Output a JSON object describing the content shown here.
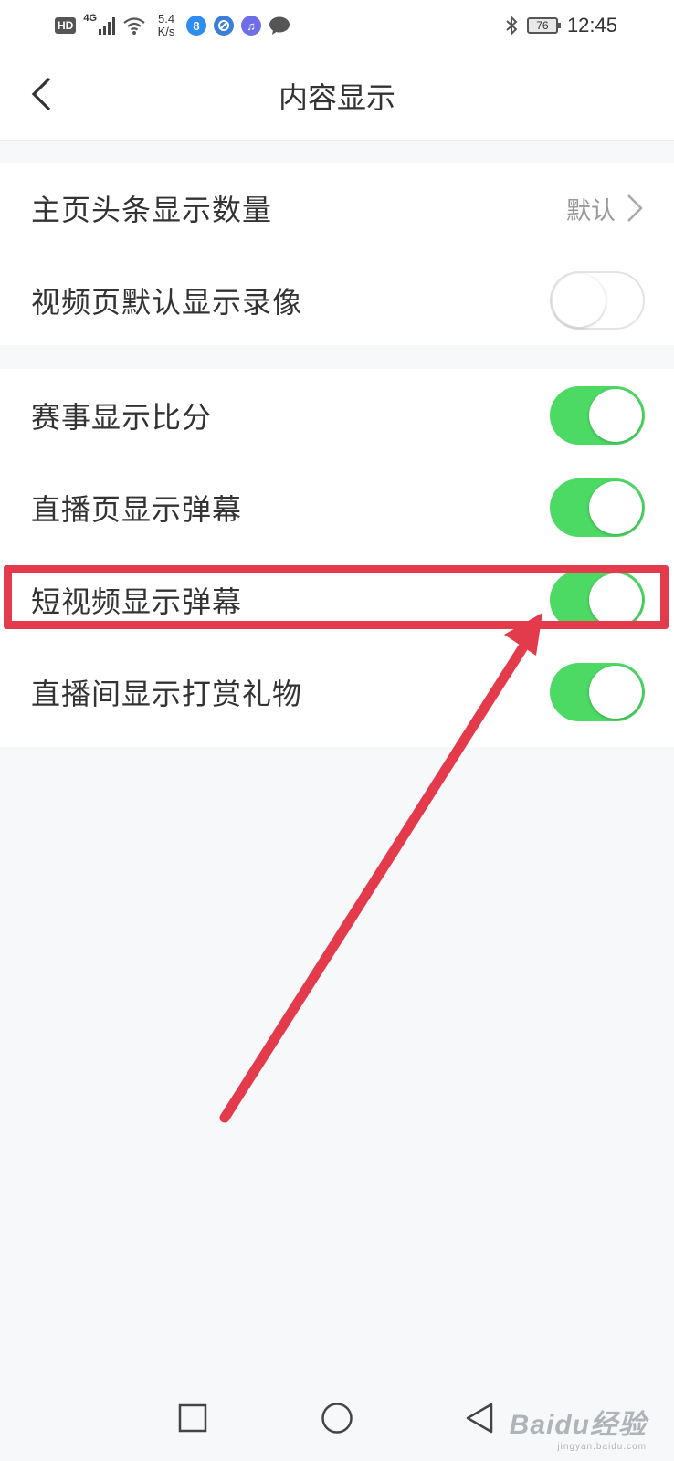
{
  "status_bar": {
    "hd": "HD",
    "network": "4G",
    "speed": "5.4\nK/s",
    "battery": "76",
    "time": "12:45",
    "icons": [
      "signal-icon",
      "wifi-icon",
      "app-8-icon",
      "browser-icon",
      "music-icon",
      "message-icon",
      "bluetooth-icon",
      "battery-icon"
    ]
  },
  "nav": {
    "title": "内容显示",
    "back_icon": "chevron-left-icon"
  },
  "settings": {
    "group1": {
      "headline_count": {
        "label": "主页头条显示数量",
        "value": "默认"
      },
      "video_default_recording": {
        "label": "视频页默认显示录像",
        "enabled": false
      }
    },
    "group2": {
      "match_score": {
        "label": "赛事显示比分",
        "enabled": true
      },
      "live_danmaku": {
        "label": "直播页显示弹幕",
        "enabled": true
      },
      "short_video_danmaku": {
        "label": "短视频显示弹幕",
        "enabled": true
      },
      "live_gifts": {
        "label": "直播间显示打赏礼物",
        "enabled": true
      }
    }
  },
  "system_nav": {
    "icons": [
      "recent-apps-icon",
      "home-icon",
      "back-triangle-icon"
    ]
  },
  "watermark": {
    "main": "Baidu经验",
    "sub": "jingyan.baidu.com"
  },
  "colors": {
    "toggle_on": "#4cd964",
    "annotation": "#e33a4c",
    "background": "#f7f8fa"
  }
}
